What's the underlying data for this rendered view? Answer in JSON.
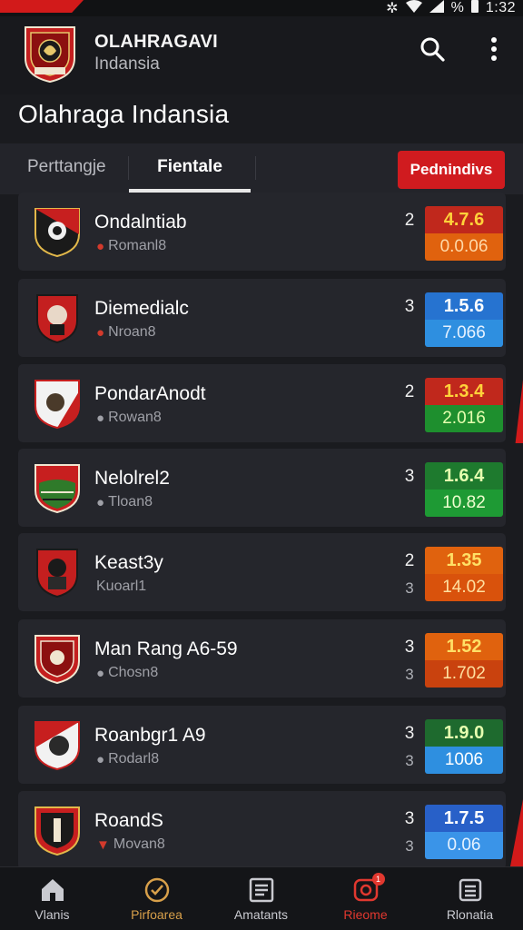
{
  "status": {
    "time": "1:32",
    "battery": "%"
  },
  "app": {
    "title": "OLAHRAGAVI",
    "subtitle": "Indansia",
    "page_title": "Olahraga Indansia"
  },
  "tabs": [
    {
      "label": "Perttangje"
    },
    {
      "label": "Fientale"
    }
  ],
  "cta": {
    "label": "Pednindivs"
  },
  "rows": [
    {
      "name": "Ondalntiab",
      "sub": "Romanl8",
      "num_top": "2",
      "num_bot": "",
      "odd_top": "4.7.6",
      "odd_bot": "0.0.06"
    },
    {
      "name": "Diemedialc",
      "sub": "Nroan8",
      "num_top": "3",
      "num_bot": "",
      "odd_top": "1.5.6",
      "odd_bot": "7.066"
    },
    {
      "name": "PondarAnodt",
      "sub": "Rowan8",
      "num_top": "2",
      "num_bot": "",
      "odd_top": "1.3.4",
      "odd_bot": "2.016"
    },
    {
      "name": "Nelolrel2",
      "sub": "Tloan8",
      "num_top": "3",
      "num_bot": "",
      "odd_top": "1.6.4",
      "odd_bot": "10.82"
    },
    {
      "name": "Keast3y",
      "sub": "Kuoarl1",
      "num_top": "2",
      "num_bot": "3",
      "odd_top": "1.35",
      "odd_bot": "14.02"
    },
    {
      "name": "Man Rang A6-59",
      "sub": "Chosn8",
      "num_top": "3",
      "num_bot": "3",
      "odd_top": "1.52",
      "odd_bot": "1.702"
    },
    {
      "name": "Roanbgr1 A9",
      "sub": "Rodarl8",
      "num_top": "3",
      "num_bot": "3",
      "odd_top": "1.9.0",
      "odd_bot": "1006"
    },
    {
      "name": "RoandS",
      "sub": "Movan8",
      "num_top": "3",
      "num_bot": "3",
      "odd_top": "1.7.5",
      "odd_bot": "0.06"
    }
  ],
  "nav": [
    {
      "label": "Vlanis",
      "icon": "home-icon"
    },
    {
      "label": "Pirfoarea",
      "icon": "check-circle-icon"
    },
    {
      "label": "Amatants",
      "icon": "list-icon"
    },
    {
      "label": "Rieome",
      "icon": "notification-icon",
      "badge": "1"
    },
    {
      "label": "Rlonatia",
      "icon": "menu-icon"
    }
  ],
  "colors": {
    "accent": "#d21a1a",
    "odd_red": "#c0281c",
    "odd_orange": "#e0620e",
    "odd_green": "#1e8f2e",
    "odd_blue": "#2673d0",
    "odd_lightblue": "#2e8fe0"
  }
}
